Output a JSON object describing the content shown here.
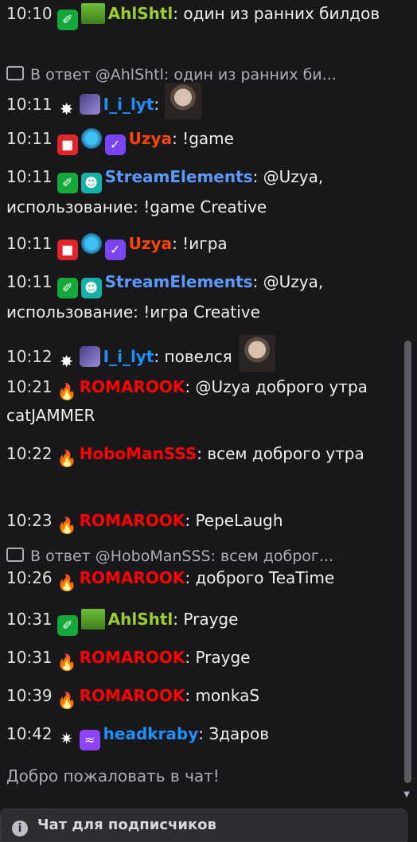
{
  "messages": [
    {
      "time": "10:10",
      "badges": [
        "sword",
        "grass"
      ],
      "user": "AhlShtl",
      "color": "#9acd32",
      "text": "один из ранних билдов",
      "emote": false
    },
    {
      "reply": "В ответ @AhlShtl: один из ранних би..."
    },
    {
      "time": "10:11",
      "badges": [
        "fire2",
        "wolf"
      ],
      "user": "I_i_lyt",
      "color": "#1e90ff",
      "text": "",
      "emote": true
    },
    {
      "time": "10:11",
      "badges": [
        "cam",
        "globe",
        "prime"
      ],
      "user": "Uzya",
      "color": "#ff4500",
      "text": "!game",
      "emote": false
    },
    {
      "time": "10:11",
      "badges": [
        "sword",
        "bot"
      ],
      "user": "StreamElements",
      "color": "#5b99ff",
      "text": "@Uzya, использование: !game Creative",
      "emote": false
    },
    {
      "time": "10:11",
      "badges": [
        "cam",
        "globe",
        "prime"
      ],
      "user": "Uzya",
      "color": "#ff4500",
      "text": "!игра",
      "emote": false
    },
    {
      "time": "10:11",
      "badges": [
        "sword",
        "bot"
      ],
      "user": "StreamElements",
      "color": "#5b99ff",
      "text": "@Uzya, использование: !игра Creative",
      "emote": false
    },
    {
      "time": "10:12",
      "badges": [
        "fire2",
        "wolf"
      ],
      "user": "I_i_lyt",
      "color": "#1e90ff",
      "text": "повелся",
      "emote": true
    },
    {
      "time": "10:21",
      "badges": [
        "fire"
      ],
      "user": "ROMAROOK",
      "color": "#ff0000",
      "text": "@Uzya доброго утра catJAMMER",
      "emote": false
    },
    {
      "time": "10:22",
      "badges": [
        "fire"
      ],
      "user": "HoboManSSS",
      "color": "#ff0000",
      "text": "всем доброго утра",
      "emote": false
    },
    {
      "time": "10:23",
      "badges": [
        "fire"
      ],
      "user": "ROMAROOK",
      "color": "#ff0000",
      "text": "PepeLaugh",
      "emote": false
    },
    {
      "reply": "В ответ @HoboManSSS: всем доброг..."
    },
    {
      "time": "10:26",
      "badges": [
        "fire"
      ],
      "user": "ROMAROOK",
      "color": "#ff0000",
      "text": "доброго TeaTime",
      "emote": false
    },
    {
      "time": "10:31",
      "badges": [
        "sword",
        "grass"
      ],
      "user": "AhlShtl",
      "color": "#9acd32",
      "text": "Prayge",
      "emote": false
    },
    {
      "time": "10:31",
      "badges": [
        "fire"
      ],
      "user": "ROMAROOK",
      "color": "#ff0000",
      "text": "Prayge",
      "emote": false
    },
    {
      "time": "10:39",
      "badges": [
        "fire"
      ],
      "user": "ROMAROOK",
      "color": "#ff0000",
      "text": "monkaS",
      "emote": false
    },
    {
      "time": "10:42",
      "badges": [
        "star",
        "purple"
      ],
      "user": "headkraby",
      "color": "#1e90ff",
      "text": "Здаров",
      "emote": false
    }
  ],
  "welcome": "Добро пожаловать в чат!",
  "subscriber_bar": "Чат для подписчиков"
}
